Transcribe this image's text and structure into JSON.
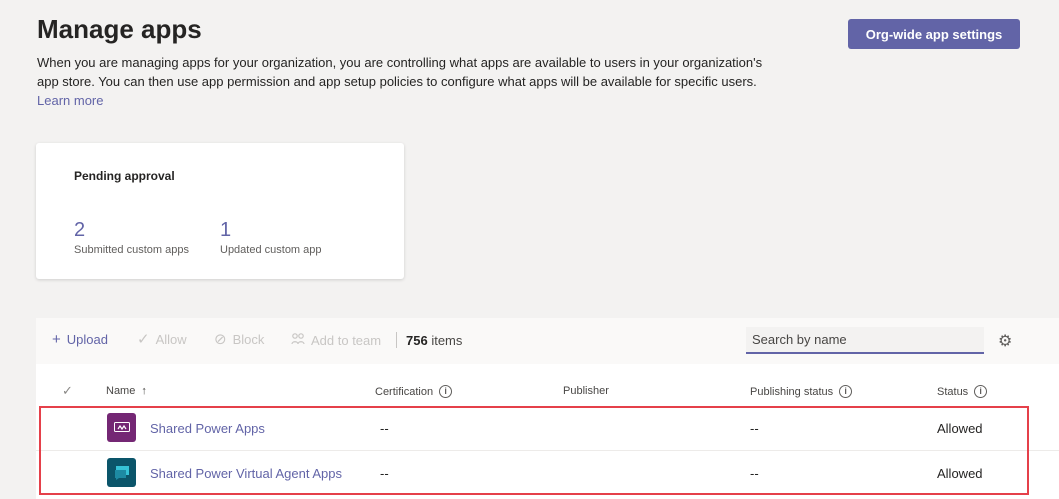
{
  "header": {
    "title": "Manage apps",
    "org_button": "Org-wide app settings",
    "description": "When you are managing apps for your organization, you are controlling what apps are available to users in your organization's app store. You can then use app permission and app setup policies to configure what apps will be available for specific users.",
    "learn_more": "Learn more"
  },
  "pending": {
    "title": "Pending approval",
    "stats": [
      {
        "count": "2",
        "label": "Submitted custom apps"
      },
      {
        "count": "1",
        "label": "Updated custom app"
      }
    ]
  },
  "toolbar": {
    "upload": "Upload",
    "allow": "Allow",
    "block": "Block",
    "add_to_team": "Add to team",
    "count": "756",
    "count_suffix": "items",
    "search_placeholder": "Search by name"
  },
  "table": {
    "columns": {
      "name": "Name",
      "certification": "Certification",
      "publisher": "Publisher",
      "publishing_status": "Publishing status",
      "status": "Status"
    },
    "rows": [
      {
        "name": "Shared Power Apps",
        "certification": "--",
        "publisher": "",
        "publishing_status": "--",
        "status": "Allowed",
        "icon": "power-apps-icon",
        "color": "#742774"
      },
      {
        "name": "Shared Power Virtual Agent Apps",
        "certification": "--",
        "publisher": "",
        "publishing_status": "--",
        "status": "Allowed",
        "icon": "power-virtual-agents-icon",
        "color": "#0b556a"
      }
    ]
  },
  "colors": {
    "accent": "#6264a7",
    "highlight": "#e5404a"
  }
}
